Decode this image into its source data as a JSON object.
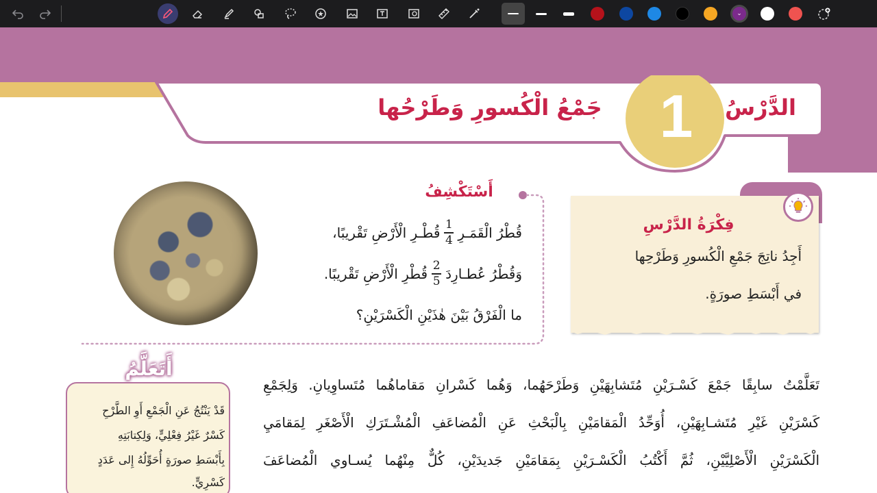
{
  "toolbar": {
    "undo_icon": "undo-icon",
    "redo_icon": "redo-icon",
    "tools": [
      "pen-icon",
      "eraser-icon",
      "highlighter-icon",
      "shapes-icon",
      "lasso-icon",
      "sticker-icon",
      "image-icon",
      "text-box-icon",
      "scan-icon",
      "ruler-icon",
      "laser-icon"
    ],
    "colors": [
      "#1a1a1a",
      "#b5121b",
      "#0d47a1",
      "#1e88e5",
      "#000000",
      "#f5a623",
      "#7b2a8c",
      "#ffffff",
      "#ef5350"
    ],
    "selected_color": "#7b2a8c"
  },
  "lesson": {
    "label": "الدَّرْسُ",
    "number": "1",
    "title": "جَمْعُ الْكُسورِ وَطَرْحُها",
    "accent_color": "#b5739f",
    "title_color": "#c8234a",
    "gold_color": "#e8c36e"
  },
  "explore": {
    "heading": "أَسْتَكْشِفُ",
    "line1_before": "قُطْرُ الْقَمَـرِ",
    "frac1_num": "1",
    "frac1_den": "4",
    "line1_after": "قُطْـرِ الْأَرْضِ تَقْريبًا،",
    "line2_before": "وَقُطْرُ عُطـارِدَ",
    "frac2_num": "2",
    "frac2_den": "5",
    "line2_after": "قُطْرِ الْأَرْضِ تَقْريبًا.",
    "line3": "ما الْفَرْقُ بَيْنَ هٰذَيْنِ الْكَسْرَيْنِ؟"
  },
  "idea": {
    "heading": "فِكْرَةُ الدَّرْسِ",
    "line1": "أَجِدُ ناتِجَ جَمْعِ الْكُسورِ وَطَرْحِها",
    "line2": "في أَبْسَطِ صورَةٍ."
  },
  "learn": {
    "badge": "أَتَعَلَّمُ",
    "lines": [
      "قَدْ يَنْتُجُ عَنِ الْجَمْعِ أَوِ الطَّرْحِ",
      "كَسْرٌ غَيْرُ فِعْلِيٍّ، وَلِكِتابَتِهِ",
      "بِأَبْسَطِ صورَةٍ أُحَوِّلُهُ إِلى عَدَدٍ",
      "كَسْرِيٍّ."
    ]
  },
  "body": {
    "lines": [
      "تَعَلَّمْتُ سابِقًا جَمْعَ كَسْـرَيْنِ مُتَشابِهَيْنِ وَطَرْحَهُما، وَهُما كَسْرانِ مَقاماهُما مُتَساوِيانِ. وَلِجَمْعِ",
      "كَسْرَيْنِ غَيْرِ مُتَشـابِهَيْنِ، أُوَحِّدُ الْمَقامَيْنِ بِالْبَحْثِ عَنِ الْمُضاعَفِ الْمُشْـتَرَكِ الْأَصْغَرِ لِمَقامَيِ",
      "الْكَسْرَيْنِ الْأَصْلِيَّيْنِ، ثُمَّ أَكْتُبُ الْكَسْـرَيْنِ بِمَقامَيْنِ جَديدَيْنِ، كُلٌّ مِنْهُما يُسـاوي الْمُضاعَفَ"
    ]
  }
}
